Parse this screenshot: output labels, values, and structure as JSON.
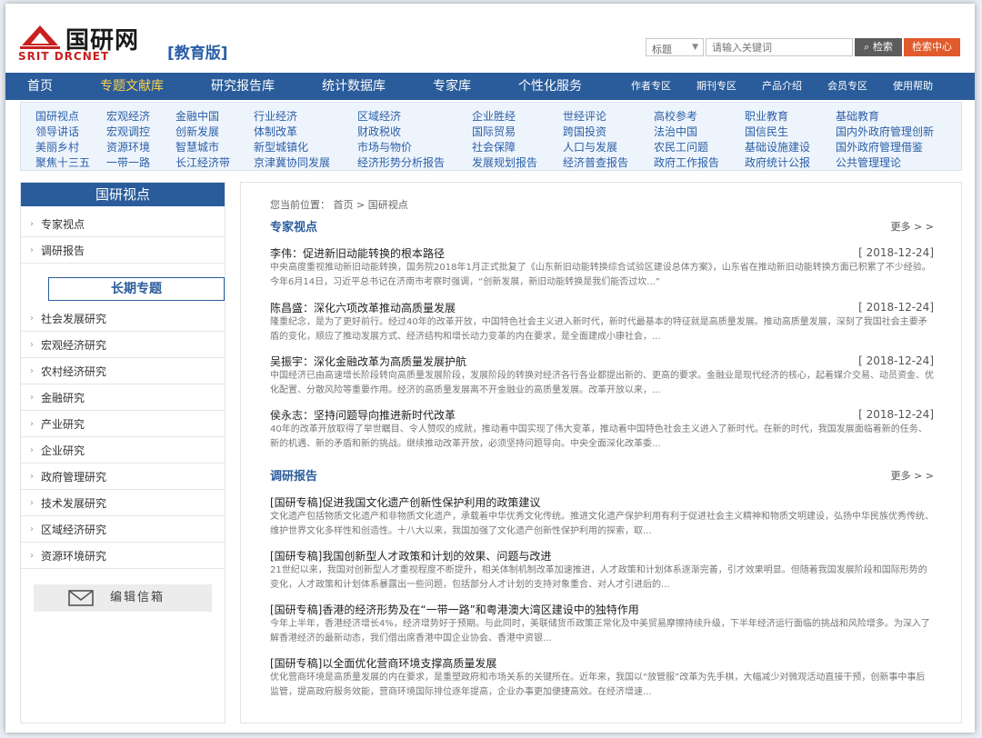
{
  "header": {
    "logo_title": "国研网",
    "logo_sub": "SRIT DRCNET",
    "logo_edition": "[教育版]",
    "search_select": "标题",
    "search_placeholder": "请输入关键词",
    "search_button": "检索",
    "search_center": "检索中心"
  },
  "mainnav": {
    "items": [
      "首页",
      "专题文献库",
      "研究报告库",
      "统计数据库",
      "专家库",
      "个性化服务"
    ],
    "sub_items": [
      "作者专区",
      "期刊专区",
      "产品介绍",
      "会员专区",
      "使用帮助"
    ]
  },
  "categories": {
    "rows": [
      [
        "国研视点",
        "宏观经济",
        "金融中国",
        "行业经济",
        "区域经济",
        "企业胜经",
        "世经评论",
        "高校参考",
        "职业教育",
        "基础教育"
      ],
      [
        "领导讲话",
        "宏观调控",
        "创新发展",
        "体制改革",
        "财政税收",
        "国际贸易",
        "跨国投资",
        "法治中国",
        "国信民生",
        "国内外政府管理创新"
      ],
      [
        "美丽乡村",
        "资源环境",
        "智慧城市",
        "新型城镇化",
        "市场与物价",
        "社会保障",
        "人口与发展",
        "农民工问题",
        "基础设施建设",
        "国外政府管理借鉴"
      ],
      [
        "聚焦十三五",
        "一带一路",
        "长江经济带",
        "京津冀协同发展",
        "经济形势分析报告",
        "发展规划报告",
        "经济普查报告",
        "政府工作报告",
        "政府统计公报",
        "公共管理理论"
      ]
    ]
  },
  "sidebar": {
    "head": "国研视点",
    "top_links": [
      "专家视点",
      "调研报告"
    ],
    "head2": "长期专题",
    "topics": [
      "社会发展研究",
      "宏观经济研究",
      "农村经济研究",
      "金融研究",
      "产业研究",
      "企业研究",
      "政府管理研究",
      "技术发展研究",
      "区域经济研究",
      "资源环境研究"
    ],
    "mail_label": "编辑信箱"
  },
  "content": {
    "crumb": "您当前位置： 首页 > 国研视点",
    "expert": {
      "title": "专家视点",
      "more": "更多 > >",
      "articles": [
        {
          "title": "李伟：促进新旧动能转换的根本路径",
          "date": "[ 2018-12-24]",
          "summary": "中央高度重视推动新旧动能转换，国务院2018年1月正式批复了《山东新旧动能转换综合试验区建设总体方案》，山东省在推动新旧动能转换方面已积累了不少经验。今年6月14日，习近平总书记在济南市考察时强调，“创新发展，新旧动能转换是我们能否过坎...”"
        },
        {
          "title": "陈昌盛：深化六项改革推动高质量发展",
          "date": "[ 2018-12-24]",
          "summary": "隆重纪念，是为了更好前行。经过40年的改革开放，中国特色社会主义进入新时代，新时代最基本的特征就是高质量发展。推动高质量发展，深刻了我国社会主要矛盾的变化，顺应了推动发展方式、经济结构和增长动力变革的内在要求，是全面建成小康社会，..."
        },
        {
          "title": "吴振宇：深化金融改革为高质量发展护航",
          "date": "[ 2018-12-24]",
          "summary": "中国经济已由高速增长阶段转向高质量发展阶段，发展阶段的转换对经济各行各业都提出新的、更高的要求。金融业是现代经济的核心，起着媒介交易、动员资金、优化配置、分散风险等重要作用。经济的高质量发展离不开金融业的高质量发展。改革开放以来，..."
        },
        {
          "title": "侯永志：坚持问题导向推进新时代改革",
          "date": "[ 2018-12-24]",
          "summary": "40年的改革开放取得了举世瞩目、令人赞叹的成就，推动着中国实现了伟大变革，推动着中国特色社会主义进入了新时代。在新的时代，我国发展面临着新的任务、新的机遇、新的矛盾和新的挑战。继续推动改革开放，必须坚持问题导向。中央全面深化改革委..."
        }
      ]
    },
    "research": {
      "title": "调研报告",
      "more": "更多 > >",
      "articles": [
        {
          "title": "[国研专稿]促进我国文化遗产创新性保护利用的政策建议",
          "summary": "文化遗产包括物质文化遗产和非物质文化遗产，承载着中华优秀文化传统。推进文化遗产保护利用有利于促进社会主义精神和物质文明建设，弘扬中华民族优秀传统、维护世界文化多样性和创造性。十八大以来，我国加强了文化遗产创新性保护利用的探索，取..."
        },
        {
          "title": "[国研专稿]我国创新型人才政策和计划的效果、问题与改进",
          "summary": "21世纪以来，我国对创新型人才重视程度不断提升，相关体制机制改革加速推进，人才政策和计划体系逐渐完善，引才效果明显。但随着我国发展阶段和国际形势的变化，人才政策和计划体系暴露出一些问题，包括部分人才计划的支持对象重合、对人才引进后的..."
        },
        {
          "title": "[国研专稿]香港的经济形势及在“一带一路”和粤港澳大湾区建设中的独特作用",
          "summary": "今年上半年，香港经济增长4%，经济增势好于预期。与此同时，美联储货币政策正常化及中美贸易摩擦持续升级，下半年经济运行面临的挑战和风险增多。为深入了解香港经济的最新动态，我们借出席香港中国企业协会、香港中资银..."
        },
        {
          "title": "[国研专稿]以全面优化营商环境支撑高质量发展",
          "summary": "优化营商环境是高质量发展的内在要求，是重塑政府和市场关系的关键所在。近年来，我国以“放管服”改革为先手棋，大幅减少对微观活动直接干预，创新事中事后监管，提高政府服务效能，营商环境国际排位逐年提高，企业办事更加便捷高效。在经济增速..."
        }
      ]
    }
  },
  "colors": {
    "brand_blue": "#2a5c9b",
    "brand_red": "#c9201f",
    "accent_orange": "#e05a2b",
    "nav_active": "#ffd24a"
  }
}
